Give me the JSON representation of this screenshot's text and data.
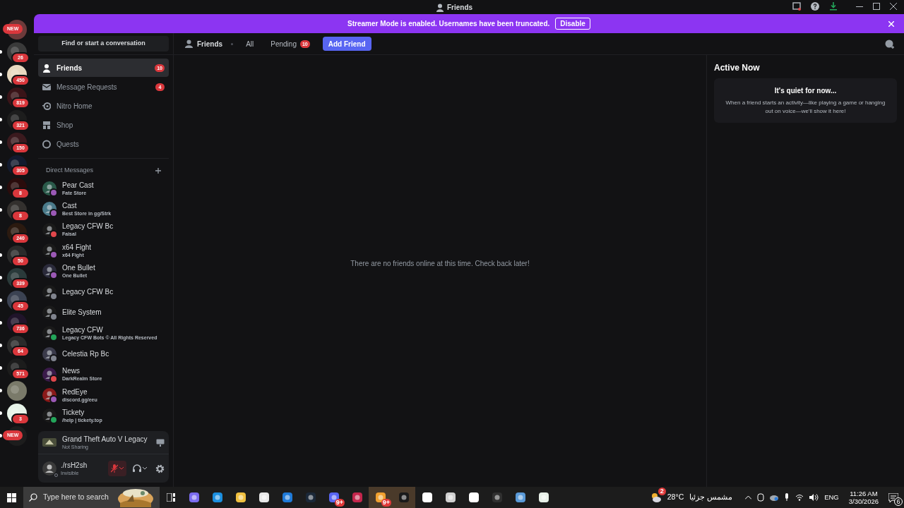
{
  "title_bar": {
    "title": "Friends"
  },
  "banner": {
    "text": "Streamer Mode is enabled. Usernames have been truncated.",
    "button": "Disable"
  },
  "servers": [
    {
      "kind": "new",
      "badge": "NEW",
      "unread": false
    },
    {
      "kind": "count",
      "badge": "26",
      "unread": true
    },
    {
      "kind": "count",
      "badge": "450",
      "unread": true
    },
    {
      "kind": "count",
      "badge": "819",
      "unread": true
    },
    {
      "kind": "count",
      "badge": "321",
      "unread": true
    },
    {
      "kind": "count",
      "badge": "150",
      "unread": true
    },
    {
      "kind": "count",
      "badge": "305",
      "unread": true
    },
    {
      "kind": "count",
      "badge": "8",
      "unread": true
    },
    {
      "kind": "count",
      "badge": "8",
      "unread": true
    },
    {
      "kind": "count",
      "badge": "240",
      "unread": false
    },
    {
      "kind": "count",
      "badge": "50",
      "unread": true
    },
    {
      "kind": "count",
      "badge": "339",
      "unread": true
    },
    {
      "kind": "count",
      "badge": "45",
      "unread": true
    },
    {
      "kind": "count",
      "badge": "736",
      "unread": true
    },
    {
      "kind": "count",
      "badge": "64",
      "unread": true
    },
    {
      "kind": "count",
      "badge": "571",
      "unread": true
    },
    {
      "kind": "plain",
      "unread": true
    },
    {
      "kind": "count",
      "badge": "3",
      "unread": true
    },
    {
      "kind": "new",
      "badge": "NEW",
      "unread": true
    }
  ],
  "search": {
    "placeholder": "Find or start a conversation"
  },
  "nav": [
    {
      "label": "Friends",
      "badge": "10",
      "selected": true
    },
    {
      "label": "Message Requests",
      "badge": "4",
      "selected": false
    },
    {
      "label": "Nitro Home",
      "selected": false
    },
    {
      "label": "Shop",
      "selected": false
    },
    {
      "label": "Quests",
      "selected": false
    }
  ],
  "direct_messages": {
    "heading": "Direct Messages",
    "items": [
      {
        "name": "Pear Cast",
        "subtitle": "Fate Store",
        "color": "#9b59b6"
      },
      {
        "name": "Cast",
        "subtitle": "Best Store in gg/Strk",
        "color": "#9b59b6"
      },
      {
        "name": "Legacy CFW Bc",
        "subtitle": "Faisal",
        "color": "#e0474c"
      },
      {
        "name": "x64 Fight",
        "subtitle": "x64 Fight",
        "color": "#9b59b6"
      },
      {
        "name": "One Bullet",
        "subtitle": "One Bullet",
        "color": "#9b59b6"
      },
      {
        "name": "Legacy CFW Bc",
        "color": "#80848e"
      },
      {
        "name": "Elite System",
        "color": "#80848e"
      },
      {
        "name": "Legacy CFW",
        "subtitle": "Legacy CFW Bots © All Rights Reserved",
        "color": "#23a55a"
      },
      {
        "name": "Celestia Rp Bc",
        "color": "#80848e"
      },
      {
        "name": "News",
        "subtitle": "DarkRealm Store",
        "color": "#e0474c"
      },
      {
        "name": "RedEye",
        "subtitle": "discord.gg/eeu",
        "color": "#9b59b6"
      },
      {
        "name": "Tickety",
        "subtitle": "/help | tickety.top",
        "color": "#23a55a"
      }
    ]
  },
  "activity": {
    "game": "Grand Theft Auto V Legacy",
    "status": "Not Sharing"
  },
  "user": {
    "name": "./rsH2sh",
    "status": "Invisible",
    "muted": true
  },
  "header": {
    "title": "Friends",
    "tabs": [
      {
        "label": "All",
        "selected": false
      },
      {
        "label": "Pending",
        "badge": "10",
        "selected": false
      }
    ],
    "add_button": "Add Friend"
  },
  "empty_message": "There are no friends online at this time. Check back later!",
  "active_now": {
    "title": "Active Now",
    "heading": "It's quiet for now...",
    "text": "When a friend starts an activity—like playing a game or hanging out on voice—we'll show it here!"
  },
  "taskbar": {
    "search_placeholder": "Type here to search",
    "apps": [
      {
        "selected": false
      },
      {
        "selected": false
      },
      {
        "selected": false
      },
      {
        "selected": false
      },
      {
        "selected": false
      },
      {
        "selected": false
      },
      {
        "selected": false,
        "badge": "9+"
      },
      {
        "selected": false
      },
      {
        "selected": true,
        "badge": "9+"
      },
      {
        "selected": true
      },
      {
        "selected": false
      },
      {
        "selected": false
      },
      {
        "selected": false
      },
      {
        "selected": false
      },
      {
        "selected": false
      },
      {
        "selected": false
      }
    ],
    "weather": {
      "alerts": "2",
      "temp": "28°C",
      "condition": "مشمس جزئيا"
    },
    "language": "ENG",
    "time": "11:26 AM",
    "date": "3/30/2026",
    "notifications": "6"
  }
}
